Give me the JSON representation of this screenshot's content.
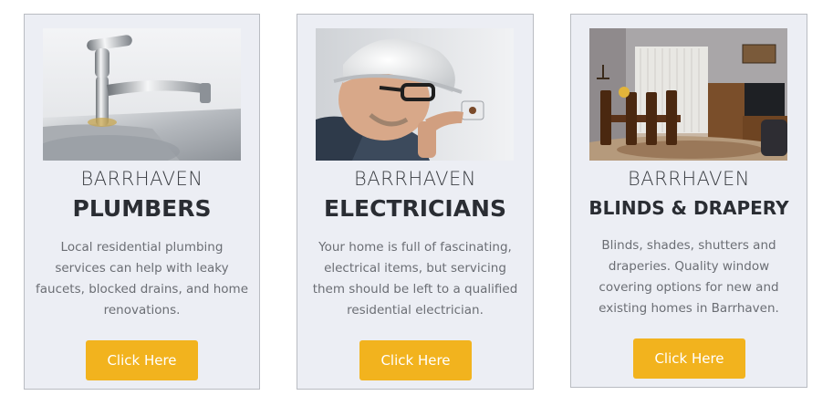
{
  "cards": [
    {
      "image_alt": "kitchen-faucet-photo",
      "city": "BARRHAVEN",
      "service": "PLUMBERS",
      "description": "Local residential plumbing services can help with leaky faucets, blocked drains, and home renovations.",
      "button_label": "Click Here"
    },
    {
      "image_alt": "electrician-at-work-photo",
      "city": "BARRHAVEN",
      "service": "ELECTRICIANS",
      "description": "Your home is full of fascinating, electrical items, but servicing them should be left to a qualified residential electrician.",
      "button_label": "Click Here"
    },
    {
      "image_alt": "living-room-with-blinds-photo",
      "city": "BARRHAVEN",
      "service": "BLINDS & DRAPERY",
      "description": "Blinds, shades, shutters and draperies. Quality window covering options for new and existing homes in Barrhaven.",
      "button_label": "Click Here"
    }
  ],
  "colors": {
    "card_background": "#ECEEF4",
    "card_border": "#B9BCC2",
    "button": "#F2B31E",
    "button_text": "#FFFFFF",
    "heading": "#2A2D33",
    "body_text": "#6B6E74"
  }
}
